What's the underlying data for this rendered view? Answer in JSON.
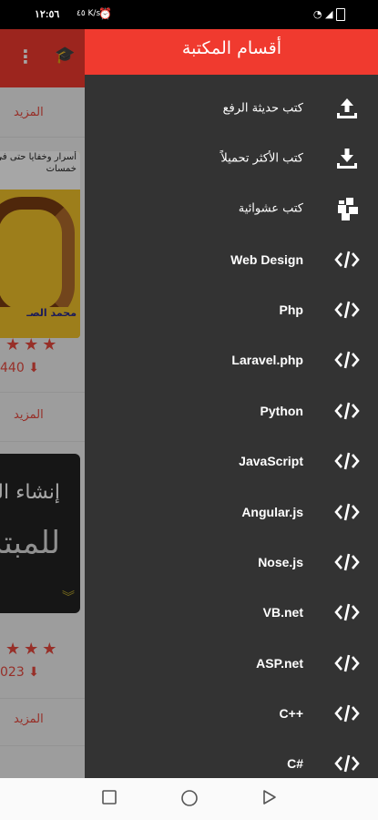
{
  "status_bar": {
    "time": "١٢:٥٦",
    "speed": "٤٥ K/s",
    "battery": "▮"
  },
  "background": {
    "more_label": "المزيد",
    "book1": {
      "cover_top": "أسرار وخفايا حتى في خمسات",
      "cover_bottom": "محمد الصـ",
      "downloads": "440"
    },
    "book2": {
      "cover_line1": "إنشاء الم",
      "cover_line2": "للمبتد",
      "downloads": "023"
    }
  },
  "drawer": {
    "title": "أقسام المكتبة",
    "items": [
      {
        "label": "كتب حديثة الرفع",
        "icon": "upload-icon"
      },
      {
        "label": "كتب الأكثر تحميلاً",
        "icon": "download-icon"
      },
      {
        "label": "كتب عشوائية",
        "icon": "shuffle-blocks-icon"
      },
      {
        "label": "Web Design",
        "icon": "code-icon"
      },
      {
        "label": "Php",
        "icon": "code-icon"
      },
      {
        "label": "Laravel.php",
        "icon": "code-icon"
      },
      {
        "label": "Python",
        "icon": "code-icon"
      },
      {
        "label": "JavaScript",
        "icon": "code-icon"
      },
      {
        "label": "Angular.js",
        "icon": "code-icon"
      },
      {
        "label": "Nose.js",
        "icon": "code-icon"
      },
      {
        "label": "VB.net",
        "icon": "code-icon"
      },
      {
        "label": "ASP.net",
        "icon": "code-icon"
      },
      {
        "label": "C++",
        "icon": "code-icon"
      },
      {
        "label": "C#",
        "icon": "code-icon"
      }
    ]
  },
  "colors": {
    "accent": "#f03a2f",
    "drawer_bg": "#333333"
  }
}
